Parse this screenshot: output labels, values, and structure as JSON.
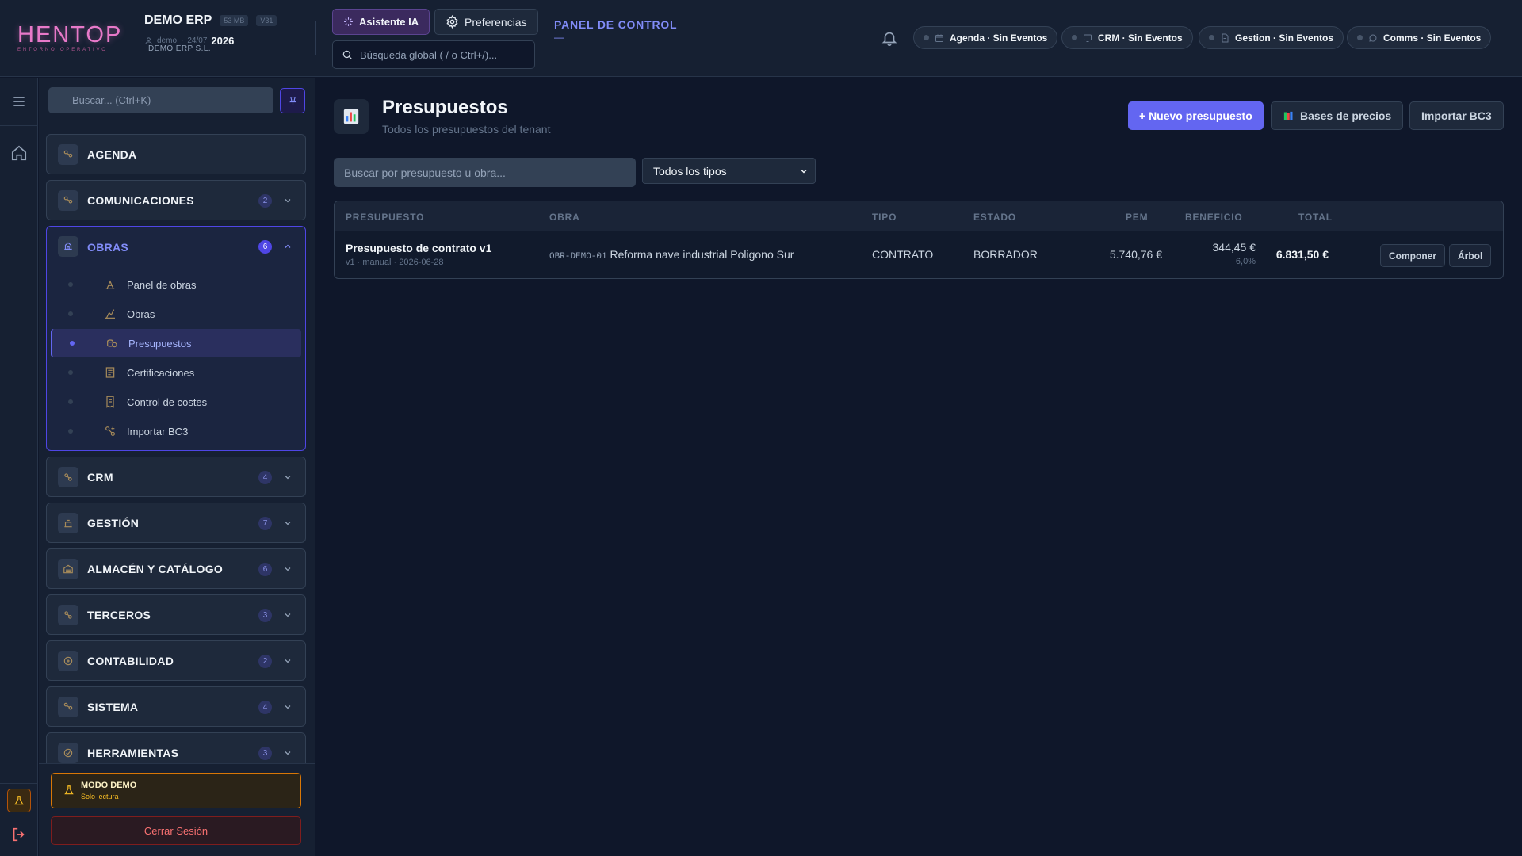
{
  "logo": {
    "text": "HENTOP",
    "subtitle": "ENTORNO OPERATIVO"
  },
  "company": {
    "name": "DEMO ERP",
    "size_tag": "53 MB",
    "version_tag": "V31",
    "legal_name": "DEMO ERP S.L.",
    "user": "demo",
    "date": "24/07",
    "year": "2026"
  },
  "header": {
    "ai_button": "Asistente IA",
    "prefs_button": "Preferencias",
    "global_search_placeholder": "Búsqueda global ( / o Ctrl+/)...",
    "panel_title": "PANEL DE CONTROL",
    "panel_value": "—",
    "pills": [
      {
        "label": "Agenda · Sin Eventos",
        "icon": "calendar-icon"
      },
      {
        "label": "CRM · Sin Eventos",
        "icon": "monitor-icon"
      },
      {
        "label": "Gestion · Sin Eventos",
        "icon": "document-icon"
      },
      {
        "label": "Comms · Sin Eventos",
        "icon": "chat-icon"
      }
    ]
  },
  "sidebar": {
    "search_placeholder": "Buscar... (Ctrl+K)",
    "sections": [
      {
        "label": "AGENDA",
        "badge": ""
      },
      {
        "label": "COMUNICACIONES",
        "badge": "2"
      },
      {
        "label": "OBRAS",
        "badge": "6",
        "expanded": true,
        "items": [
          {
            "label": "Panel de obras",
            "active": false
          },
          {
            "label": "Obras",
            "active": false
          },
          {
            "label": "Presupuestos",
            "active": true
          },
          {
            "label": "Certificaciones",
            "active": false
          },
          {
            "label": "Control de costes",
            "active": false
          },
          {
            "label": "Importar BC3",
            "active": false
          }
        ]
      },
      {
        "label": "CRM",
        "badge": "4"
      },
      {
        "label": "GESTIÓN",
        "badge": "7"
      },
      {
        "label": "ALMACÉN Y CATÁLOGO",
        "badge": "6"
      },
      {
        "label": "TERCEROS",
        "badge": "3"
      },
      {
        "label": "CONTABILIDAD",
        "badge": "2"
      },
      {
        "label": "SISTEMA",
        "badge": "4"
      },
      {
        "label": "HERRAMIENTAS",
        "badge": "3"
      }
    ],
    "demo_title": "MODO DEMO",
    "demo_sub": "Solo lectura",
    "logout": "Cerrar Sesión"
  },
  "page": {
    "title": "Presupuestos",
    "subtitle": "Todos los presupuestos del tenant",
    "new_button": "+ Nuevo presupuesto",
    "bases_button": "Bases de precios",
    "import_button": "Importar BC3",
    "search_placeholder": "Buscar por presupuesto u obra...",
    "type_filter": "Todos los tipos"
  },
  "table": {
    "columns": [
      "PRESUPUESTO",
      "OBRA",
      "TIPO",
      "ESTADO",
      "PEM",
      "BENEFICIO",
      "TOTAL"
    ],
    "rows": [
      {
        "title": "Presupuesto de contrato v1",
        "meta": "v1 · manual · 2026-06-28",
        "obra_code": "OBR-DEMO-01",
        "obra_name": "Reforma nave industrial Poligono Sur",
        "tipo": "CONTRATO",
        "estado": "BORRADOR",
        "pem": "5.740,76 €",
        "beneficio": "344,45 €",
        "beneficio_pct": "6,0%",
        "total": "6.831,50 €",
        "action1": "Componer",
        "action2": "Árbol"
      }
    ]
  },
  "colors": {
    "accent": "#6366f1",
    "brand": "#e879c9",
    "warning": "#fbbf24",
    "danger": "#f87171"
  }
}
